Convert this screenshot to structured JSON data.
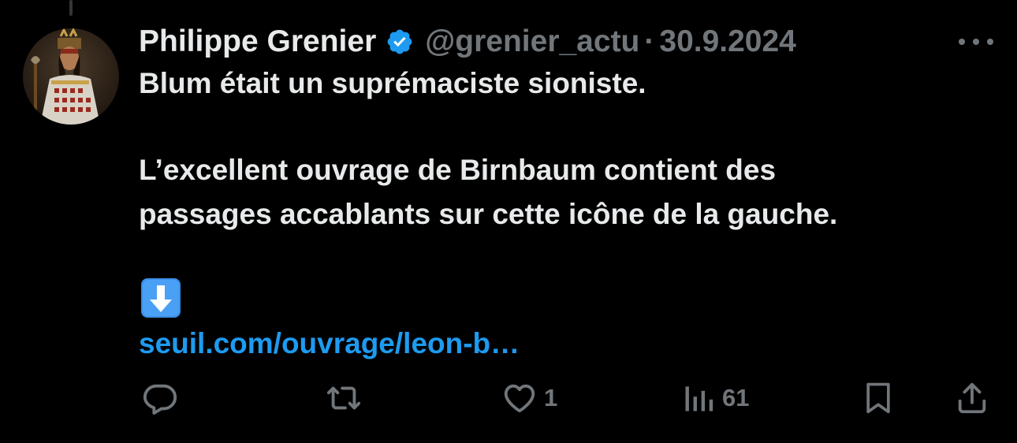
{
  "tweet": {
    "author_name": "Philippe Grenier",
    "handle": "@grenier_actu",
    "separator": "·",
    "date": "30.9.2024",
    "lines": [
      "Blum était un suprémaciste sioniste.",
      "L’excellent ouvrage de Birnbaum contient des",
      "passages accablants sur cette icône de la gauche."
    ],
    "link_text": "seuil.com/ouvrage/leon-b…"
  },
  "actions": {
    "reply_icon": "reply-icon",
    "retweet_icon": "retweet-icon",
    "like_icon": "heart-icon",
    "like_count": "1",
    "views_icon": "views-icon",
    "views_count": "61",
    "bookmark_icon": "bookmark-icon",
    "share_icon": "share-icon"
  },
  "colors": {
    "background": "#000000",
    "text": "#e7e9ea",
    "muted": "#71767b",
    "link": "#1d9bf0",
    "verified": "#1d9bf0"
  }
}
